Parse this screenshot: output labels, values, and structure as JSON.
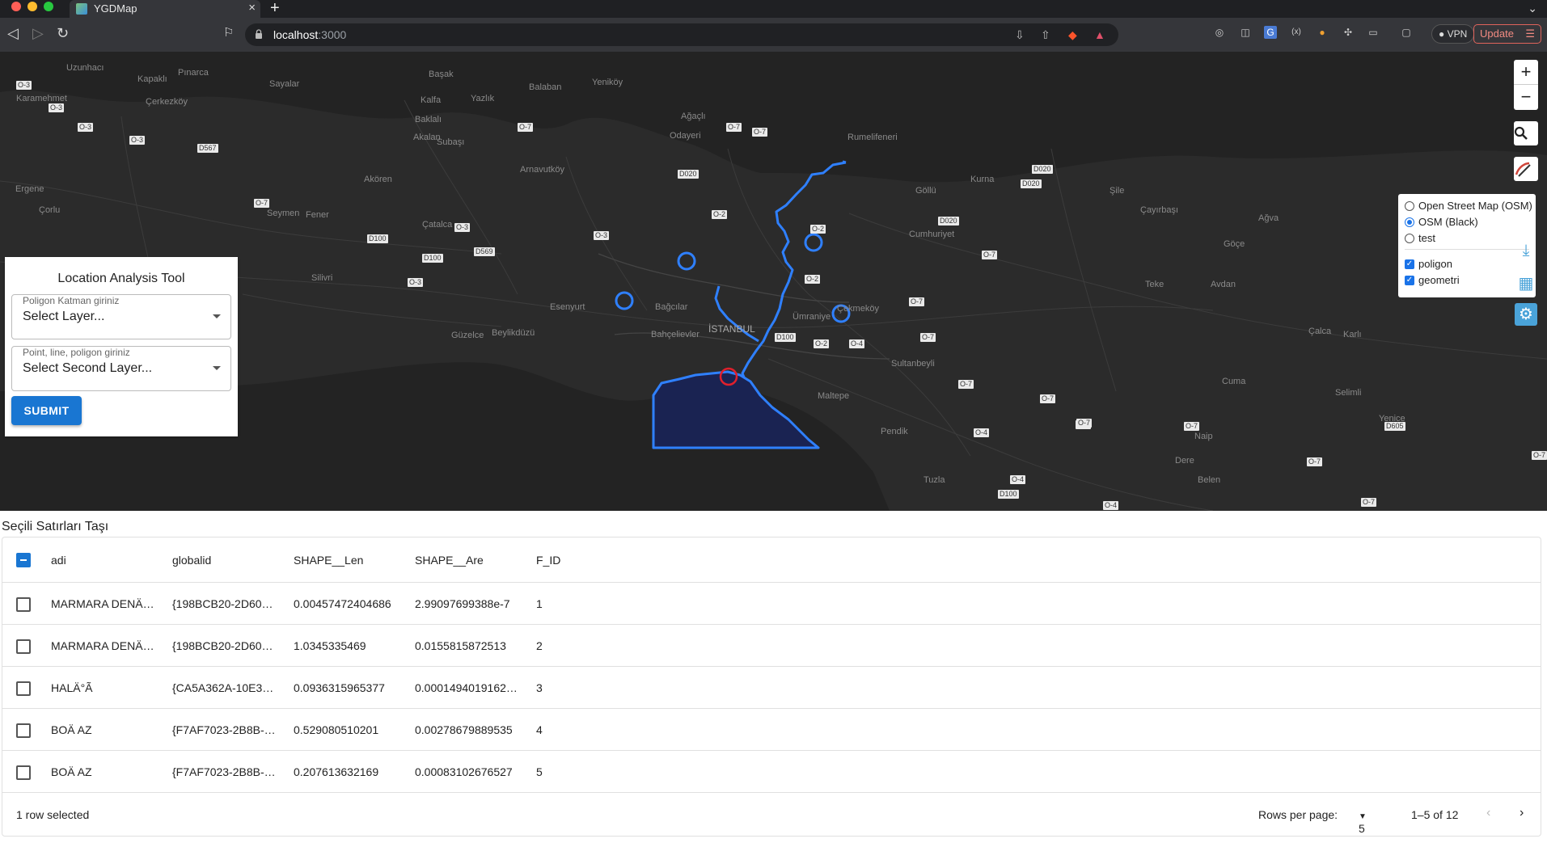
{
  "browser": {
    "tab_title": "YGDMap",
    "url_host": "localhost",
    "url_port": ":3000",
    "vpn_label": "VPN",
    "update_label": "Update"
  },
  "map": {
    "zoom_in": "+",
    "zoom_out": "−",
    "places": [
      "Uzunhacı",
      "Pınarca",
      "Karamehmet",
      "Kapaklı",
      "Çerkezköy",
      "Sayalar",
      "Başak",
      "Balaban",
      "Yeniköy",
      "Kalfa",
      "Yazlık",
      "Ağaçlı",
      "Baklalı",
      "Akalan",
      "Odayeri",
      "Rumelifeneri",
      "Subaşı",
      "Arnavutköy",
      "Ergene",
      "Çorlu",
      "Akören",
      "Seymen",
      "Fener",
      "Çatalca",
      "Kurna",
      "Göllü",
      "Şile",
      "Çayırbaşı",
      "Ağva",
      "Cumhuriyet",
      "Göçe",
      "Silivri",
      "Esenyurt",
      "Bağcılar",
      "İSTANBUL",
      "Güzelce",
      "Beylikdüzü",
      "Bahçelievler",
      "Ümraniye",
      "Çekmeköy",
      "Teke",
      "Avdan",
      "Çalca",
      "Sultanbeyli",
      "Maltepe",
      "Karlı",
      "Pendik",
      "Cuma",
      "Selimli",
      "Yenice",
      "Naip",
      "Dere",
      "Belen",
      "Tuzla"
    ],
    "roads": [
      "O-3",
      "O-3",
      "O-3",
      "O-3",
      "D567",
      "O-7",
      "O-7",
      "O-7",
      "O-7",
      "D020",
      "O-2",
      "O-3",
      "O-3",
      "D100",
      "D569",
      "D100",
      "O-2",
      "D020",
      "D020",
      "D020",
      "O-7",
      "O-2",
      "D100",
      "O-2",
      "O-4",
      "O-7",
      "O-7",
      "O-7",
      "O-7",
      "O-7",
      "O-4",
      "O-4",
      "D100",
      "O-4",
      "O-7",
      "D605",
      "O-7",
      "O-7",
      "O-7",
      "O-7",
      "O-3"
    ],
    "layers": {
      "base_options": [
        "Open Street Map (OSM)",
        "OSM (Black)",
        "test"
      ],
      "selected_base": "OSM (Black)",
      "overlays": [
        "poligon",
        "geometri"
      ]
    }
  },
  "tool": {
    "title": "Location Analysis Tool",
    "first_label": "Poligon Katman giriniz",
    "first_value": "Select Layer...",
    "second_label": "Point, line, poligon giriniz",
    "second_value": "Select Second Layer...",
    "submit": "SUBMIT"
  },
  "table": {
    "title": "Seçili Satırları Taşı",
    "columns": [
      "adi",
      "globalid",
      "SHAPE__Len",
      "SHAPE__Are",
      "F_ID"
    ],
    "rows": [
      [
        "MARMARA DENÄ…",
        "{198BCB20-2D60…",
        "0.00457472404686",
        "2.99097699388e-7",
        "1"
      ],
      [
        "MARMARA DENÄ…",
        "{198BCB20-2D60…",
        "1.0345335469",
        "0.0155815872513",
        "2"
      ],
      [
        "HALÄ°Ã",
        "{CA5A362A-10E3…",
        "0.0936315965377",
        "0.0001494019162…",
        "3"
      ],
      [
        "BOÄ AZ",
        "{F7AF7023-2B8B-…",
        "0.529080510201",
        "0.00278679889535",
        "4"
      ],
      [
        "BOÄ AZ",
        "{F7AF7023-2B8B-…",
        "0.207613632169",
        "0.00083102676527",
        "5"
      ]
    ],
    "selected_text": "1 row selected",
    "rows_per_page_label": "Rows per page:",
    "rows_per_page": "5",
    "range": "1–5 of 12"
  },
  "colors": {
    "map_bg": "#2b2b2b",
    "feature_stroke": "#2f80ff",
    "feature_fill": "#1a2352",
    "accent": "#1976d2",
    "point_red": "#e0202c"
  }
}
